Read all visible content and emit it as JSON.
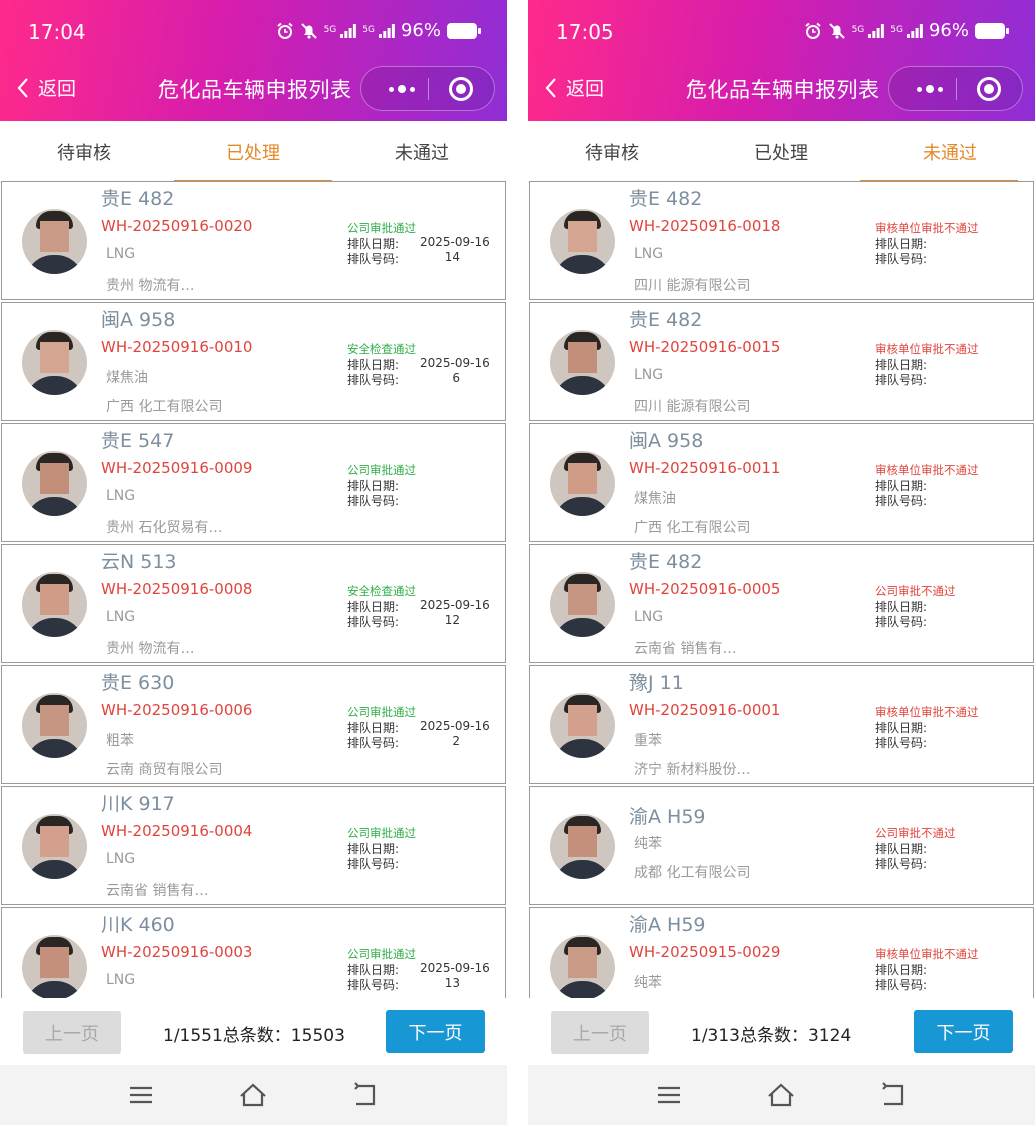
{
  "screens": [
    {
      "status_time": "17:04",
      "battery": "96%",
      "back_label": "返回",
      "title": "危化品车辆申报列表",
      "tabs": [
        "待审核",
        "已处理",
        "未通过"
      ],
      "active_tab": 1,
      "cards": [
        {
          "plate": "贵E 482",
          "code": "WH-20250916-0020",
          "cargo": "LNG",
          "company": "贵州 物流有…",
          "status": "公司审批通过",
          "status_kind": "ok",
          "queue_date_label": "排队日期:",
          "queue_date": "2025-09-16",
          "queue_no_label": "排队号码:",
          "queue_no": "14"
        },
        {
          "plate": "闽A 958",
          "code": "WH-20250916-0010",
          "cargo": "煤焦油",
          "company": "广西 化工有限公司",
          "status": "安全检查通过",
          "status_kind": "ok",
          "queue_date_label": "排队日期:",
          "queue_date": "2025-09-16",
          "queue_no_label": "排队号码:",
          "queue_no": "6"
        },
        {
          "plate": "贵E 547",
          "code": "WH-20250916-0009",
          "cargo": "LNG",
          "company": "贵州 石化贸易有…",
          "status": "公司审批通过",
          "status_kind": "ok",
          "queue_date_label": "排队日期:",
          "queue_date": "",
          "queue_no_label": "排队号码:",
          "queue_no": ""
        },
        {
          "plate": "云N 513",
          "code": "WH-20250916-0008",
          "cargo": "LNG",
          "company": "贵州 物流有…",
          "status": "安全检查通过",
          "status_kind": "ok",
          "queue_date_label": "排队日期:",
          "queue_date": "2025-09-16",
          "queue_no_label": "排队号码:",
          "queue_no": "12"
        },
        {
          "plate": "贵E 630",
          "code": "WH-20250916-0006",
          "cargo": "粗苯",
          "company": "云南 商贸有限公司",
          "status": "公司审批通过",
          "status_kind": "ok",
          "queue_date_label": "排队日期:",
          "queue_date": "2025-09-16",
          "queue_no_label": "排队号码:",
          "queue_no": "2"
        },
        {
          "plate": "川K 917",
          "code": "WH-20250916-0004",
          "cargo": "LNG",
          "company": "云南省 销售有…",
          "status": "公司审批通过",
          "status_kind": "ok",
          "queue_date_label": "排队日期:",
          "queue_date": "",
          "queue_no_label": "排队号码:",
          "queue_no": ""
        },
        {
          "plate": "川K 460",
          "code": "WH-20250916-0003",
          "cargo": "LNG",
          "company": "",
          "status": "公司审批通过",
          "status_kind": "ok",
          "queue_date_label": "排队日期:",
          "queue_date": "2025-09-16",
          "queue_no_label": "排队号码:",
          "queue_no": "13"
        }
      ],
      "pager": {
        "prev": "上一页",
        "info": "1/1551总条数：15503",
        "next": "下一页"
      }
    },
    {
      "status_time": "17:05",
      "battery": "96%",
      "back_label": "返回",
      "title": "危化品车辆申报列表",
      "tabs": [
        "待审核",
        "已处理",
        "未通过"
      ],
      "active_tab": 2,
      "cards": [
        {
          "plate": "贵E 482",
          "code": "WH-20250916-0018",
          "cargo": "LNG",
          "company": "四川 能源有限公司",
          "status": "审核单位审批不通过",
          "status_kind": "fail",
          "queue_date_label": "排队日期:",
          "queue_date": "",
          "queue_no_label": "排队号码:",
          "queue_no": ""
        },
        {
          "plate": "贵E 482",
          "code": "WH-20250916-0015",
          "cargo": "LNG",
          "company": "四川 能源有限公司",
          "status": "审核单位审批不通过",
          "status_kind": "fail",
          "queue_date_label": "排队日期:",
          "queue_date": "",
          "queue_no_label": "排队号码:",
          "queue_no": ""
        },
        {
          "plate": "闽A 958",
          "code": "WH-20250916-0011",
          "cargo": "煤焦油",
          "company": "广西 化工有限公司",
          "status": "审核单位审批不通过",
          "status_kind": "fail",
          "queue_date_label": "排队日期:",
          "queue_date": "",
          "queue_no_label": "排队号码:",
          "queue_no": ""
        },
        {
          "plate": "贵E 482",
          "code": "WH-20250916-0005",
          "cargo": "LNG",
          "company": "云南省 销售有…",
          "status": "公司审批不通过",
          "status_kind": "fail",
          "queue_date_label": "排队日期:",
          "queue_date": "",
          "queue_no_label": "排队号码:",
          "queue_no": ""
        },
        {
          "plate": "豫J 11",
          "code": "WH-20250916-0001",
          "cargo": "重苯",
          "company": "济宁 新材料股份…",
          "status": "审核单位审批不通过",
          "status_kind": "fail",
          "queue_date_label": "排队日期:",
          "queue_date": "",
          "queue_no_label": "排队号码:",
          "queue_no": ""
        },
        {
          "plate": "渝A H59",
          "code": "",
          "cargo": "纯苯",
          "company": "成都 化工有限公司",
          "status": "公司审批不通过",
          "status_kind": "fail",
          "queue_date_label": "排队日期:",
          "queue_date": "",
          "queue_no_label": "排队号码:",
          "queue_no": ""
        },
        {
          "plate": "渝A H59",
          "code": "WH-20250915-0029",
          "cargo": "纯苯",
          "company": "",
          "status": "审核单位审批不通过",
          "status_kind": "fail",
          "queue_date_label": "排队日期:",
          "queue_date": "",
          "queue_no_label": "排队号码:",
          "queue_no": ""
        }
      ],
      "pager": {
        "prev": "上一页",
        "info": "1/313总条数：3124",
        "next": "下一页"
      }
    }
  ],
  "colors": {
    "accent_tab": "#e38a2a",
    "code_red": "#e0443c",
    "status_green": "#2fae49",
    "next_blue": "#1797d3"
  },
  "icons": {
    "back": "chevron-left-icon",
    "more": "more-dots-icon",
    "close": "target-icon",
    "menu": "menu-icon",
    "home": "home-icon",
    "return": "return-icon"
  }
}
